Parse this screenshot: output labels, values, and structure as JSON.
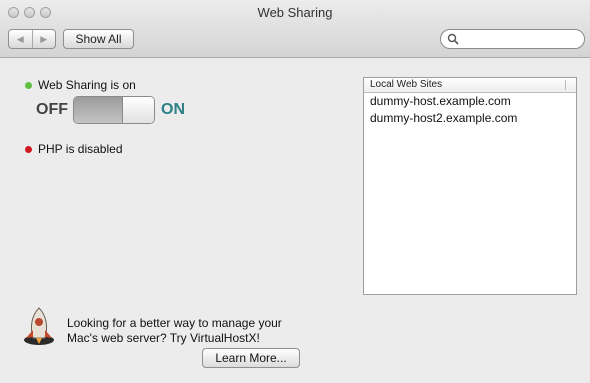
{
  "window": {
    "title": "Web Sharing"
  },
  "toolbar": {
    "show_all_label": "Show All",
    "search_placeholder": ""
  },
  "web_sharing": {
    "status": "Web Sharing is on",
    "status_color": "#5fbf3f",
    "off_label": "OFF",
    "on_label": "ON",
    "state": "on"
  },
  "php": {
    "status": "PHP is disabled",
    "status_color": "#d0181f"
  },
  "sites": {
    "header": "Local Web Sites",
    "items": [
      "dummy-host.example.com",
      "dummy-host2.example.com"
    ]
  },
  "promo": {
    "line1": "Looking for a better way to manage your",
    "line2": "Mac's web server? Try VirtualHostX!",
    "button_label": "Learn More..."
  }
}
